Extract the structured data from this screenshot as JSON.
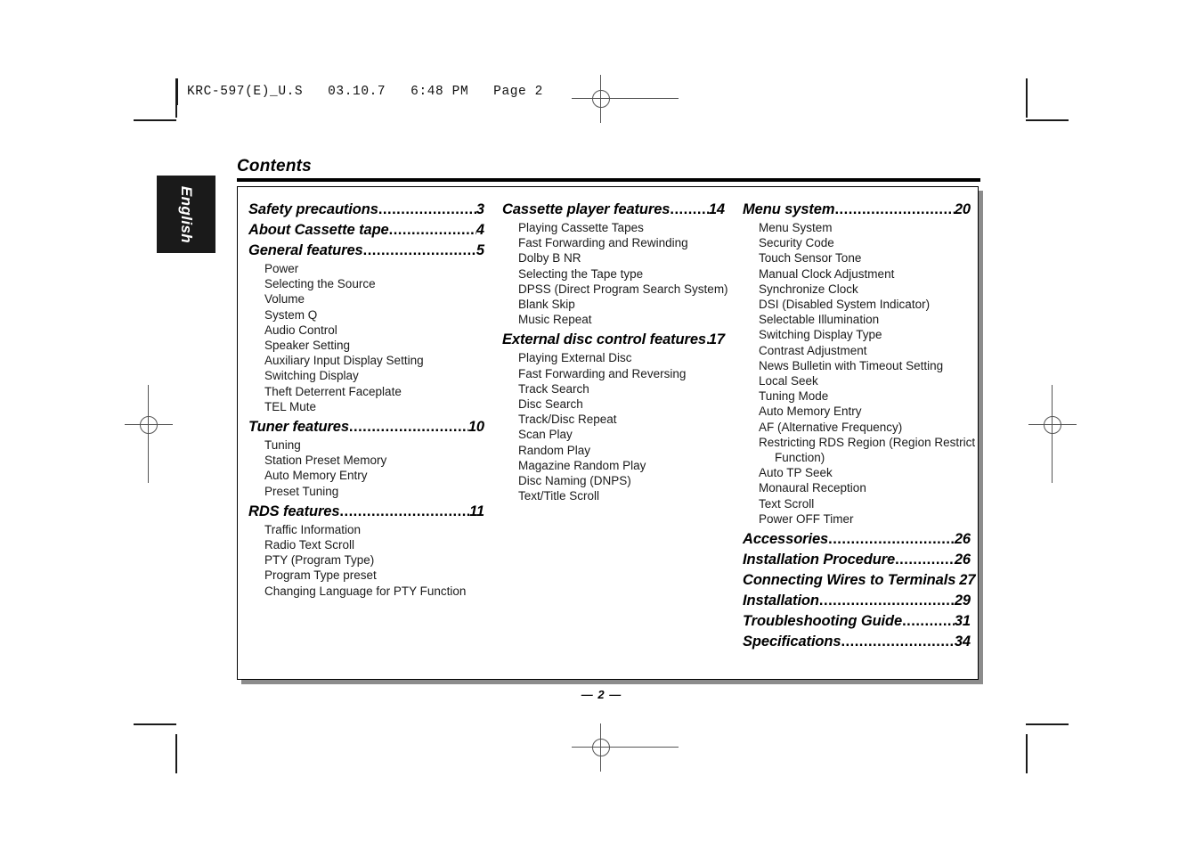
{
  "file_header": "KRC-597(E)_U.S   03.10.7   6:48 PM   Page 2",
  "language_tab": "English",
  "page_title": "Contents",
  "page_number": "— 2 —",
  "columns": [
    {
      "id": "column-1",
      "sections": [
        {
          "title": "Safety precautions",
          "page": "3",
          "dots": true,
          "items": []
        },
        {
          "title": "About Cassette tape",
          "page": "4",
          "dots": true,
          "items": []
        },
        {
          "title": "General features",
          "page": "5",
          "dots": true,
          "items": [
            "Power",
            "Selecting the Source",
            "Volume",
            "System Q",
            "Audio Control",
            "Speaker Setting",
            "Auxiliary Input Display Setting",
            "Switching Display",
            "Theft Deterrent Faceplate",
            "TEL Mute"
          ]
        },
        {
          "title": "Tuner features",
          "page": "10",
          "dots": true,
          "items": [
            "Tuning",
            "Station Preset Memory",
            "Auto Memory Entry",
            "Preset Tuning"
          ]
        },
        {
          "title": "RDS features",
          "page": "11",
          "dots": true,
          "items": [
            "Traffic Information",
            "Radio Text Scroll",
            "PTY (Program Type)",
            "Program Type preset",
            "Changing Language for PTY Function"
          ]
        }
      ]
    },
    {
      "id": "column-2",
      "sections": [
        {
          "title": "Cassette player features",
          "page": "14",
          "dots": true,
          "items": [
            "Playing Cassette Tapes",
            "Fast Forwarding and Rewinding",
            "Dolby B NR",
            "Selecting the Tape type",
            "DPSS (Direct Program Search System)",
            "Blank Skip",
            "Music Repeat"
          ]
        },
        {
          "title": "External disc control features",
          "page": "17",
          "dots": true,
          "items": [
            "Playing External Disc",
            "Fast Forwarding and Reversing",
            "Track Search",
            "Disc Search",
            "Track/Disc Repeat",
            "Scan Play",
            "Random Play",
            "Magazine Random Play",
            "Disc Naming (DNPS)",
            "Text/Title Scroll"
          ]
        }
      ]
    },
    {
      "id": "column-3",
      "sections": [
        {
          "title": "Menu system",
          "page": "20",
          "dots": true,
          "items": [
            "Menu System",
            "Security Code",
            "Touch Sensor Tone",
            "Manual Clock Adjustment",
            "Synchronize Clock",
            "DSI (Disabled System Indicator)",
            "Selectable Illumination",
            "Switching Display Type",
            "Contrast Adjustment",
            "News Bulletin with Timeout Setting",
            "Local Seek",
            "Tuning Mode",
            "Auto Memory Entry",
            "AF (Alternative Frequency)",
            "Restricting RDS Region (Region Restrict Function)",
            "Auto TP Seek",
            "Monaural Reception",
            "Text Scroll",
            "Power OFF Timer"
          ]
        },
        {
          "title": "Accessories",
          "page": "26",
          "dots": true,
          "items": []
        },
        {
          "title": "Installation Procedure",
          "page": "26",
          "dots": true,
          "items": []
        },
        {
          "title": "Connecting Wires to Terminals",
          "page": "27",
          "dots": false,
          "items": []
        },
        {
          "title": "Installation",
          "page": "29",
          "dots": true,
          "items": []
        },
        {
          "title": "Troubleshooting Guide",
          "page": "31",
          "dots": true,
          "items": []
        },
        {
          "title": "Specifications",
          "page": "34",
          "dots": true,
          "items": []
        }
      ]
    }
  ]
}
